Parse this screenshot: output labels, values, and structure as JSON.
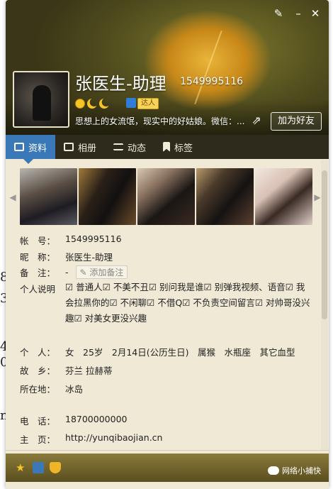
{
  "profile": {
    "name": "张医生-助理",
    "uid": "1549995116",
    "badge": "达人",
    "signature": "思想上的女流氓，现实中的好姑娘。微信：...",
    "add_friend": "加为好友"
  },
  "tabs": [
    {
      "label": "资料",
      "icon": "profile-card-icon"
    },
    {
      "label": "相册",
      "icon": "photo-album-icon"
    },
    {
      "label": "动态",
      "icon": "feed-list-icon"
    },
    {
      "label": "标签",
      "icon": "bookmark-icon"
    }
  ],
  "info": {
    "account": {
      "label": "帐　号：",
      "value": "1549995116"
    },
    "nickname": {
      "label": "昵　称：",
      "value": "张医生-助理"
    },
    "remark": {
      "label": "备　注：",
      "value": "-",
      "button": "添加备注"
    },
    "intro": {
      "label": "个人说明",
      "value": "☑ 普通人☑ 不美不丑☑ 别问我是谁☑ 别弹我视频、语音☑ 我会拉黑你的☑ 不闲聊☑ 不借Q☑ 不负责空间留言☑ 对帅哥没兴趣☑ 对美女更没兴趣"
    },
    "personal": {
      "label": "个　人：",
      "value": "女　25岁　2月14日(公历生日)　属猴　水瓶座　其它血型"
    },
    "hometown": {
      "label": "故　乡：",
      "value": "芬兰 拉赫蒂"
    },
    "location": {
      "label": "所在地：",
      "value": "冰岛"
    },
    "phone": {
      "label": "电　话：",
      "value": "18700000000"
    },
    "homepage": {
      "label": "主　页：",
      "value": "http://yunqibaojian.cn"
    }
  },
  "footer": {
    "wechat_label": "网络小捕快"
  },
  "background_text": {
    "g1": "8",
    "g2": "3",
    "g3": "4",
    "g4": "0",
    "g5": "n"
  }
}
